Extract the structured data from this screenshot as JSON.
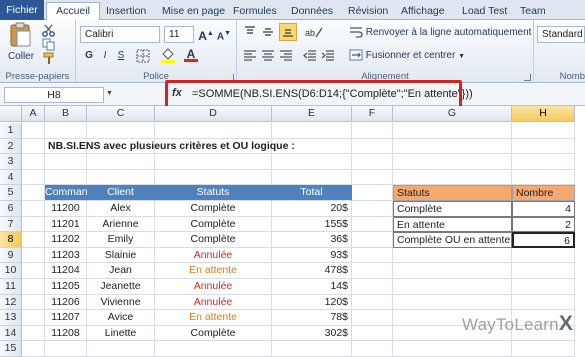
{
  "tabs": [
    "Fichier",
    "Accueil",
    "Insertion",
    "Mise en page",
    "Formules",
    "Données",
    "Révision",
    "Affichage",
    "Load Test",
    "Team"
  ],
  "ribbon": {
    "paste_label": "Coller",
    "clipboard_group": "Presse-papiers",
    "font_group": "Police",
    "align_group": "Alignement",
    "number_group": "Nomb",
    "font_name": "Calibri",
    "font_size": "11",
    "wrap_label": "Renvoyer à la ligne automatiquement",
    "merge_label": "Fusionner et centrer",
    "number_format": "Standard",
    "bold": "G",
    "italic": "I",
    "underline": "S"
  },
  "formula_bar": {
    "name_box": "H8",
    "fx": "fx",
    "formula": "=SOMME(NB.SI.ENS(D6:D14;{\"Complète\";\"En attente\"}))"
  },
  "columns": [
    "A",
    "B",
    "C",
    "D",
    "E",
    "F",
    "G",
    "H"
  ],
  "rows": [
    "1",
    "2",
    "3",
    "4",
    "5",
    "6",
    "7",
    "8",
    "9",
    "10",
    "11",
    "12",
    "13",
    "14",
    "15"
  ],
  "sheet": {
    "title": "NB.SI.ENS avec plusieurs critères et OU logique :",
    "table_headers": [
      "Commande",
      "Client",
      "Statuts",
      "Total"
    ],
    "table_rows": [
      [
        "11200",
        "Alex",
        "Complète",
        "20$"
      ],
      [
        "11201",
        "Arienne",
        "Complète",
        "155$"
      ],
      [
        "11202",
        "Emily",
        "Complète",
        "36$"
      ],
      [
        "11203",
        "Slainie",
        "Annulée",
        "93$"
      ],
      [
        "11204",
        "Jean",
        "En attente",
        "478$"
      ],
      [
        "11205",
        "Jeanette",
        "Annulée",
        "14$"
      ],
      [
        "11206",
        "Vivienne",
        "Annulée",
        "120$"
      ],
      [
        "11207",
        "Avice",
        "En attente",
        "78$"
      ],
      [
        "11208",
        "Linette",
        "Complète",
        "302$"
      ]
    ],
    "summary_headers": [
      "Statuts",
      "Nombre"
    ],
    "summary_rows": [
      [
        "Complète",
        "4"
      ],
      [
        "En attente",
        "2"
      ],
      [
        "Complète OU en attente",
        "6"
      ]
    ]
  },
  "colors": {
    "header_blue": "#4f81bd",
    "annulee": "#e3231b",
    "en_attente": "#e47b12",
    "summary_header": "#f6a86f",
    "highlight_red": "#d9201e"
  },
  "watermark": {
    "text": "WayToLearn",
    "mark": "X"
  }
}
